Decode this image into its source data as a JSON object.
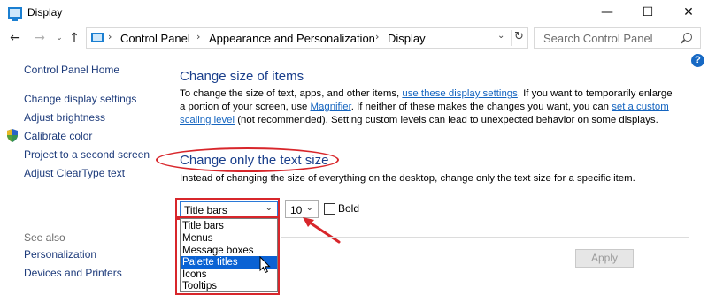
{
  "window": {
    "title": "Display",
    "minimize_glyph": "—",
    "maximize_glyph": "☐",
    "close_glyph": "✕"
  },
  "nav": {
    "back_glyph": "←",
    "forward_glyph": "→",
    "recent_glyph": "⌄",
    "up_glyph": "↑"
  },
  "address": {
    "crumbs": [
      "Control Panel",
      "Appearance and Personalization",
      "Display"
    ],
    "separator": "›",
    "dropdown_glyph": "⌄",
    "refresh_glyph": "↻"
  },
  "search": {
    "placeholder": "Search Control Panel"
  },
  "help": {
    "label": "?"
  },
  "sidebar": {
    "links": [
      "Control Panel Home",
      "Change display settings",
      "Adjust brightness",
      "Calibrate color",
      "Project to a second screen",
      "Adjust ClearType text"
    ],
    "see_also": "See also",
    "see_also_links": [
      "Personalization",
      "Devices and Printers"
    ]
  },
  "section1": {
    "heading": "Change size of items",
    "text_a": "To change the size of text, apps, and other items, ",
    "link_a": "use these display settings",
    "text_b": ".  If you want to temporarily enlarge a portion of your screen, use ",
    "link_b": "Magnifier",
    "text_c": ".  If neither of these makes the changes you want, you can ",
    "link_c": "set a custom scaling level",
    "text_d": " (not recommended).  Setting custom levels can lead to unexpected behavior on some displays."
  },
  "section2": {
    "heading": "Change only the text size",
    "description": "Instead of changing the size of everything on the desktop, change only the text size for a specific item."
  },
  "controls": {
    "item_select_value": "Title bars",
    "size_select_value": "10",
    "chevron": "⌄",
    "bold_label": "Bold",
    "bold_checked": false,
    "dropdown_options": [
      "Title bars",
      "Menus",
      "Message boxes",
      "Palette titles",
      "Icons",
      "Tooltips"
    ],
    "highlighted_option": "Palette titles",
    "apply_label": "Apply"
  },
  "colors": {
    "annotation_red": "#d8262b",
    "link_blue": "#1565c0",
    "heading_blue": "#1a3f8c",
    "selection_blue": "#0a62d4"
  }
}
